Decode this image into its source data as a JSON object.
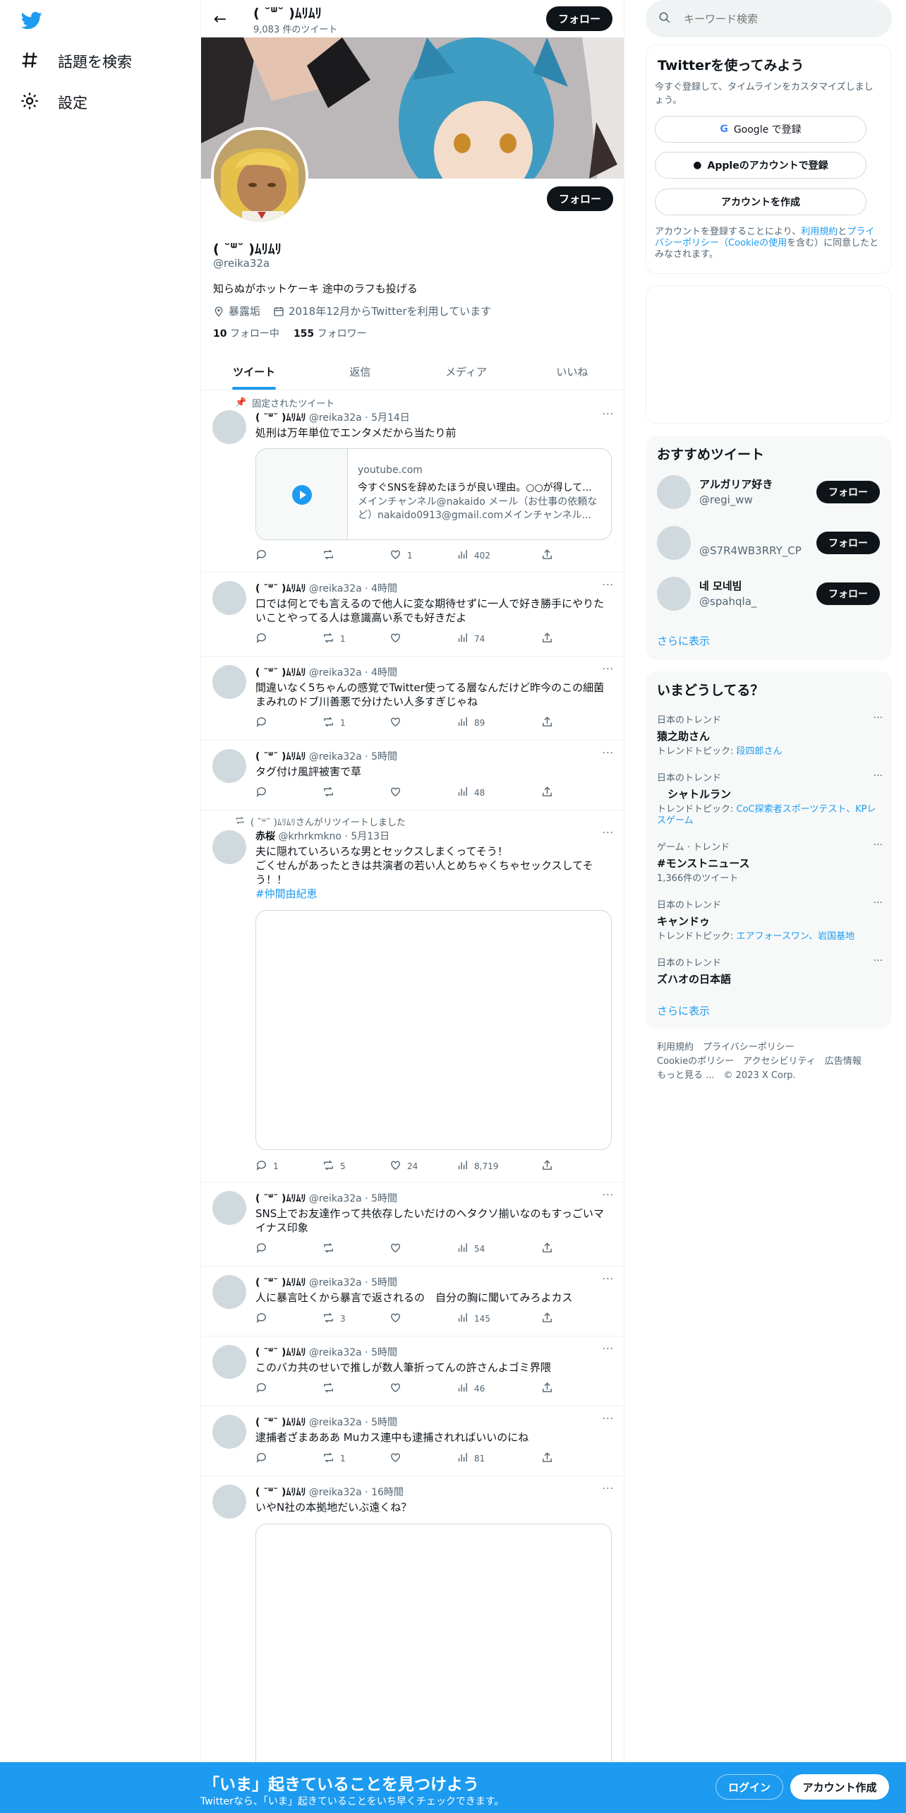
{
  "nav": {
    "explore": "話題を検索",
    "settings": "設定"
  },
  "topbar": {
    "name": "( ˘ᐜ˘ )ﾑﾘﾑﾘ",
    "count": "9,083 件のツイート",
    "follow": "フォロー"
  },
  "profile": {
    "name": "( ˘ᐜ˘ )ﾑﾘﾑﾘ",
    "handle": "@reika32a",
    "follow": "フォロー",
    "bio": "知らぬがホットケーキ 途中のラフも投げる",
    "location": "暴露垢",
    "joined": "2018年12月からTwitterを利用しています",
    "following_count": "10",
    "following_label": "フォロー中",
    "followers_count": "155",
    "followers_label": "フォロワー"
  },
  "tabs": [
    "ツイート",
    "返信",
    "メディア",
    "いいね"
  ],
  "pinned_label": "固定されたツイート",
  "retweet_label": "( ˘ᐜ˘ )ﾑﾘﾑﾘさんがリツイートしました",
  "tweets": [
    {
      "name": "( ˘ᐜ˘ )ﾑﾘﾑﾘ",
      "handle": "@reika32a",
      "time": "5月14日",
      "text": "処刑は万年単位でエンタメだから当たり前",
      "card": {
        "domain": "youtube.com",
        "title": "今すぐSNSを辞めたほうが良い理由。○○が得して...",
        "desc": "メインチャンネル@nakaido メール（お仕事の依頼など）nakaido0913@gmail.comメインチャンネル..."
      },
      "reply": "",
      "rt": "",
      "like": "1",
      "views": "402"
    },
    {
      "name": "( ˘ᐜ˘ )ﾑﾘﾑﾘ",
      "handle": "@reika32a",
      "time": "4時間",
      "text": "口では何とでも言えるので他人に変な期待せずに一人で好き勝手にやりたいことやってる人は意識高い系でも好きだよ",
      "reply": "",
      "rt": "1",
      "like": "",
      "views": "74"
    },
    {
      "name": "( ˘ᐜ˘ )ﾑﾘﾑﾘ",
      "handle": "@reika32a",
      "time": "4時間",
      "text": "間違いなく5ちゃんの感覚でTwitter使ってる層なんだけど昨今のこの細菌まみれのドブ川善悪で分けたい人多すぎじゃね",
      "reply": "",
      "rt": "1",
      "like": "",
      "views": "89"
    },
    {
      "name": "( ˘ᐜ˘ )ﾑﾘﾑﾘ",
      "handle": "@reika32a",
      "time": "5時間",
      "text": "タグ付け風評被害で草",
      "reply": "",
      "rt": "",
      "like": "",
      "views": "48"
    },
    {
      "name": "赤桜",
      "handle": "@krhrkmkno",
      "time": "5月13日",
      "text": "夫に隠れていろいろな男とセックスしまくってそう！\nごくせんがあったときは共演者の若い人とめちゃくちゃセックスしてそう！！",
      "tag": "#仲間由紀恵",
      "reply": "1",
      "rt": "5",
      "like": "24",
      "views": "8,719"
    },
    {
      "name": "( ˘ᐜ˘ )ﾑﾘﾑﾘ",
      "handle": "@reika32a",
      "time": "5時間",
      "text": "SNS上でお友達作って共依存したいだけのヘタクソ揃いなのもすっごいマイナス印象",
      "reply": "",
      "rt": "",
      "like": "",
      "views": "54"
    },
    {
      "name": "( ˘ᐜ˘ )ﾑﾘﾑﾘ",
      "handle": "@reika32a",
      "time": "5時間",
      "text": "人に暴言吐くから暴言で返されるの　自分の胸に聞いてみろよカス",
      "reply": "",
      "rt": "3",
      "like": "",
      "views": "145"
    },
    {
      "name": "( ˘ᐜ˘ )ﾑﾘﾑﾘ",
      "handle": "@reika32a",
      "time": "5時間",
      "text": "このバカ共のせいで推しが数人筆折ってんの許さんよゴミ界隈",
      "reply": "",
      "rt": "",
      "like": "",
      "views": "46"
    },
    {
      "name": "( ˘ᐜ˘ )ﾑﾘﾑﾘ",
      "handle": "@reika32a",
      "time": "5時間",
      "text": "逮捕者ざまあああ Muカス連中も逮捕されればいいのにね",
      "reply": "",
      "rt": "1",
      "like": "",
      "views": "81"
    },
    {
      "name": "( ˘ᐜ˘ )ﾑﾘﾑﾘ",
      "handle": "@reika32a",
      "time": "16時間",
      "text": "いやN社の本拠地だいぶ遠くね？",
      "reply": "",
      "rt": "",
      "like": "",
      "views": ""
    }
  ],
  "search": {
    "placeholder": "キーワード検索"
  },
  "signup": {
    "title": "Twitterを使ってみよう",
    "subtitle": "今すぐ登録して、タイムラインをカスタマイズしましょう。",
    "google": "Google で登録",
    "apple": "Appleのアカウントで登録",
    "create": "アカウントを作成",
    "terms_a": "アカウントを登録することにより、",
    "terms_link1": "利用規約",
    "terms_b": "と",
    "terms_link2": "プライバシーポリシー（Cookieの使用",
    "terms_c": "を含む）に同意したとみなされます。"
  },
  "recommend": {
    "title": "おすすめツイート",
    "users": [
      {
        "name": "アルガリア好き",
        "handle": "@regi_ww",
        "follow": "フォロー"
      },
      {
        "name": "",
        "handle": "@S7R4WB3RRY_CP",
        "follow": "フォロー"
      },
      {
        "name": "네 모네빔",
        "handle": "@spahqla_",
        "follow": "フォロー"
      }
    ],
    "more": "さらに表示"
  },
  "trends": {
    "title": "いまどうしてる？",
    "items": [
      {
        "cat": "日本のトレンド",
        "title": "猿之助さん",
        "sub_label": "トレンドトピック: ",
        "sub_link": "段四郎さん"
      },
      {
        "cat": "日本のトレンド",
        "title": "　シャトルラン",
        "sub_label": "トレンドトピック: ",
        "sub_link": "CoC探索者スポーツテスト、KPレスゲーム"
      },
      {
        "cat": "ゲーム · トレンド",
        "title": "#モンストニュース",
        "sub_label": "1,366件のツイート",
        "sub_link": ""
      },
      {
        "cat": "日本のトレンド",
        "title": "キャンドゥ",
        "sub_label": "トレンドトピック: ",
        "sub_link": "エアフォースワン、岩国基地"
      },
      {
        "cat": "日本のトレンド",
        "title": "ズハオの日本語",
        "sub_label": "",
        "sub_link": ""
      }
    ],
    "more": "さらに表示"
  },
  "footer": {
    "l1": "利用規約　プライバシーポリシー",
    "l2": "Cookieのポリシー　アクセシビリティ　広告情報",
    "l3": "もっと見る ...　© 2023 X Corp."
  },
  "bottom": {
    "title": "「いま」起きていることを見つけよう",
    "sub": "Twitterなら、「いま」起きていることをいち早くチェックできます。",
    "login": "ログイン",
    "signup": "アカウント作成"
  },
  "colors": {
    "accent": "#1d9bf0",
    "dark": "#0f1419",
    "muted": "#536471"
  }
}
